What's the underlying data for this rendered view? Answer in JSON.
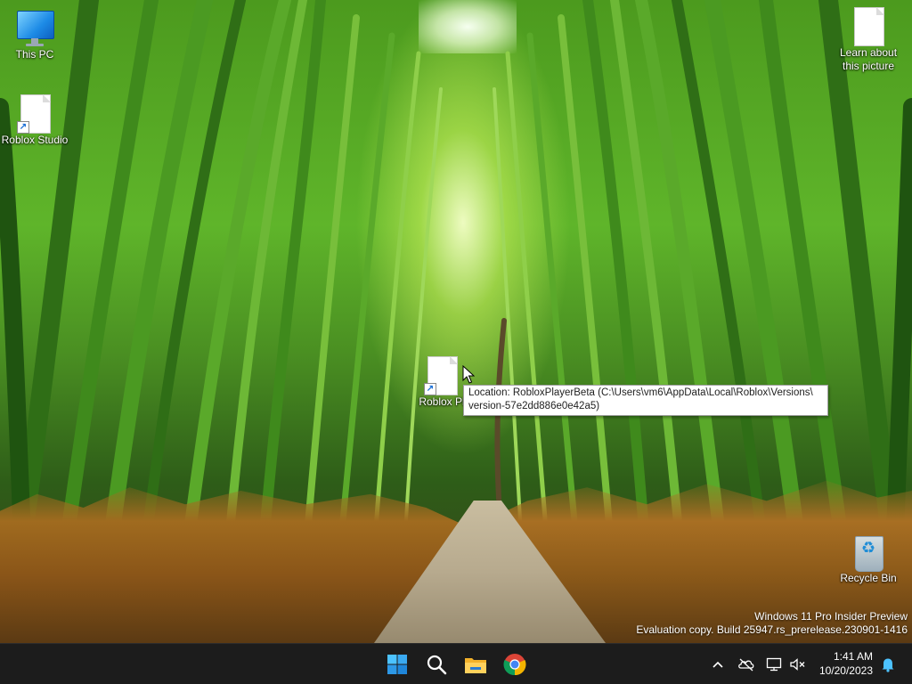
{
  "desktop": {
    "icons": [
      {
        "label": "This PC",
        "icon": "monitor-icon"
      },
      {
        "label": "Roblox Studio",
        "icon": "document-shortcut-icon"
      },
      {
        "label": "Roblox Pl",
        "icon": "document-shortcut-icon"
      },
      {
        "label": "Learn about this picture",
        "icon": "document-icon"
      },
      {
        "label": "Recycle Bin",
        "icon": "recycle-bin-icon"
      }
    ]
  },
  "tooltip": {
    "line1": "Location: RobloxPlayerBeta (C:\\Users\\vm6\\AppData\\Local\\Roblox\\Versions\\",
    "line2": "version-57e2dd886e0e42a5)"
  },
  "watermark": {
    "line1": "Windows 11 Pro Insider Preview",
    "line2": "Evaluation copy. Build 25947.rs_prerelease.230901-1416"
  },
  "taskbar": {
    "apps": [
      {
        "name": "start-icon"
      },
      {
        "name": "search-icon"
      },
      {
        "name": "file-explorer-icon"
      },
      {
        "name": "chrome-icon"
      }
    ],
    "tray": [
      "chevron-up-icon",
      "onedrive-offline-icon",
      "network-icon",
      "volume-muted-icon"
    ],
    "time": "1:41 AM",
    "date": "10/20/2023",
    "colors": {
      "background": "#1c1c1c",
      "accent": "#4cc2ff"
    }
  }
}
